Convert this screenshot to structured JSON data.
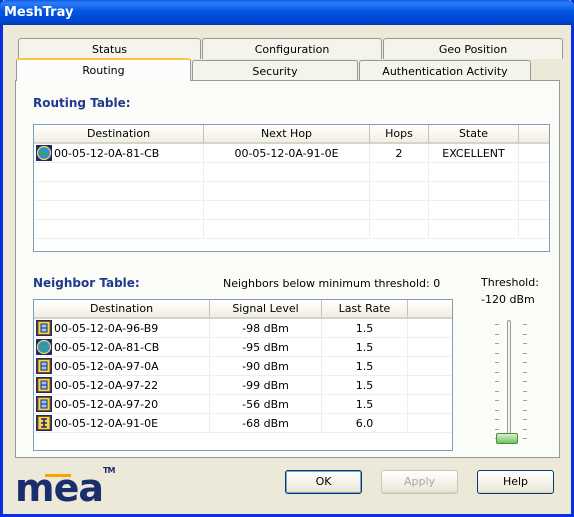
{
  "window": {
    "title": "MeshTray"
  },
  "tabs_row1": [
    "Status",
    "Configuration",
    "Geo Position"
  ],
  "tabs_row2": [
    "Routing",
    "Security",
    "Authentication Activity"
  ],
  "active_tab": "Routing",
  "routing": {
    "title": "Routing Table:",
    "columns": [
      "Destination",
      "Next Hop",
      "Hops",
      "State"
    ],
    "rows": [
      {
        "icon": "globe-icon",
        "destination": "00-05-12-0A-81-CB",
        "next_hop": "00-05-12-0A-91-0E",
        "hops": "2",
        "state": "EXCELLENT"
      }
    ]
  },
  "neighbor": {
    "title": "Neighbor Table:",
    "below_threshold_text": "Neighbors below minimum threshold: 0",
    "columns": [
      "Destination",
      "Signal Level",
      "Last Rate"
    ],
    "rows": [
      {
        "icon": "device-icon",
        "destination": "00-05-12-0A-96-B9",
        "signal": "-98 dBm",
        "rate": "1.5"
      },
      {
        "icon": "globe-icon",
        "destination": "00-05-12-0A-81-CB",
        "signal": "-95 dBm",
        "rate": "1.5"
      },
      {
        "icon": "device-icon",
        "destination": "00-05-12-0A-97-0A",
        "signal": "-90 dBm",
        "rate": "1.5"
      },
      {
        "icon": "device-icon",
        "destination": "00-05-12-0A-97-22",
        "signal": "-99 dBm",
        "rate": "1.5"
      },
      {
        "icon": "device-icon",
        "destination": "00-05-12-0A-97-20",
        "signal": "-56 dBm",
        "rate": "1.5"
      },
      {
        "icon": "network-device-icon",
        "destination": "00-05-12-0A-91-0E",
        "signal": "-68 dBm",
        "rate": "6.0"
      }
    ]
  },
  "threshold": {
    "label": "Threshold:",
    "value": "-120 dBm",
    "level": 0
  },
  "buttons": {
    "ok": "OK",
    "apply": "Apply",
    "help": "Help"
  },
  "logo": {
    "text": "mea",
    "tm": "TM"
  }
}
